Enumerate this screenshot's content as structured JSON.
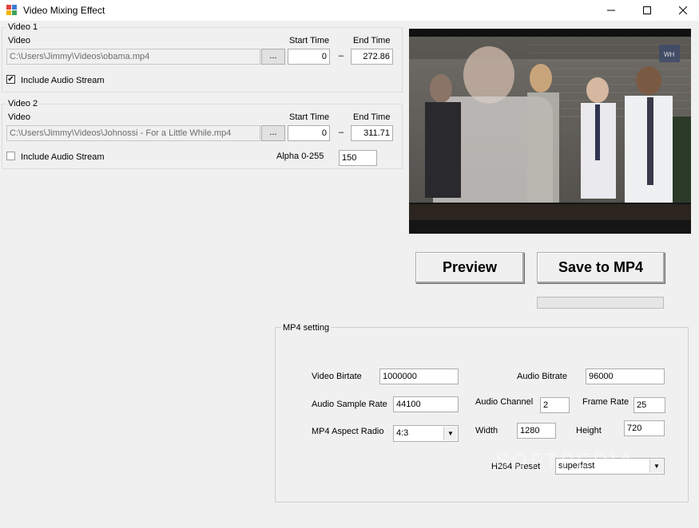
{
  "window": {
    "title": "Video Mixing Effect",
    "controls": {
      "minimize": "—",
      "maximize": "☐",
      "close": "✕"
    }
  },
  "video1": {
    "group_label": "Video 1",
    "video_label": "Video",
    "path": "C:\\Users\\Jimmy\\Videos\\obama.mp4",
    "browse_label": "...",
    "start_label": "Start Time",
    "end_label": "End Time",
    "start_value": "0",
    "dash": "–",
    "end_value": "272.86",
    "include_audio_label": "Include Audio Stream",
    "include_audio_checked": true
  },
  "video2": {
    "group_label": "Video 2",
    "video_label": "Video",
    "path": "C:\\Users\\Jimmy\\Videos\\Johnossi - For a Little While.mp4",
    "browse_label": "...",
    "start_label": "Start Time",
    "end_label": "End Time",
    "start_value": "0",
    "dash": "–",
    "end_value": "311.71",
    "include_audio_label": "Include Audio Stream",
    "include_audio_checked": false,
    "alpha_label": "Alpha 0-255",
    "alpha_value": "150"
  },
  "actions": {
    "preview_label": "Preview",
    "save_label": "Save to MP4",
    "progress": 0
  },
  "mp4": {
    "group_label": "MP4 setting",
    "video_bitrate_label": "Video Birtate",
    "video_bitrate": "1000000",
    "audio_bitrate_label": "Audio Bitrate",
    "audio_bitrate": "96000",
    "sample_rate_label": "Audio Sample Rate",
    "sample_rate": "44100",
    "audio_channel_label": "Audio Channel",
    "audio_channel": "2",
    "frame_rate_label": "Frame Rate",
    "frame_rate": "25",
    "aspect_label": "MP4 Aspect Radio",
    "aspect_value": "4:3",
    "width_label": "Width",
    "width_value": "1280",
    "height_label": "Height",
    "height_value": "720",
    "preset_label": "H264 Preset",
    "preset_value": "superfast"
  },
  "watermark": "SOFTPEDIA"
}
